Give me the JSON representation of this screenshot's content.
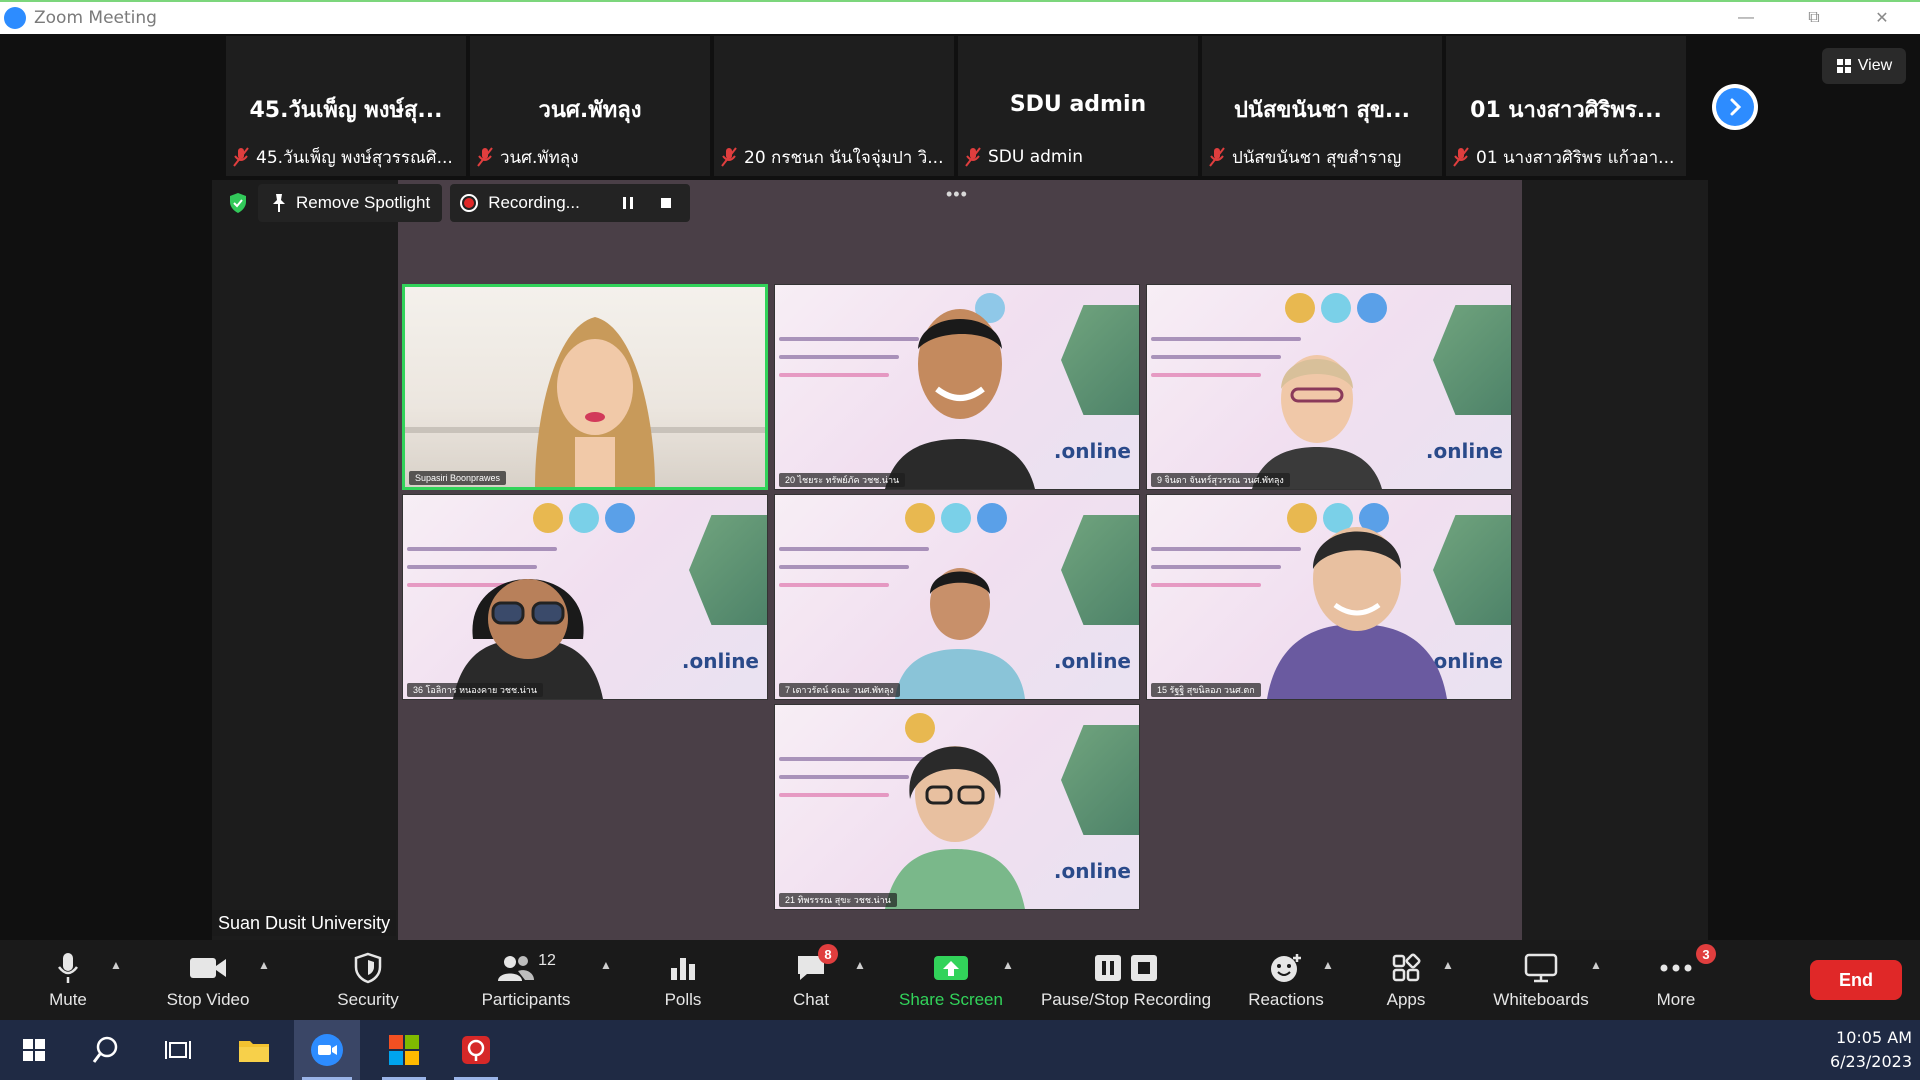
{
  "window": {
    "title": "Zoom Meeting"
  },
  "filmstrip": [
    {
      "name": "45.วันเพ็ญ พงษ์สุ...",
      "sub": "45.วันเพ็ญ พงษ์สุวรรณศิ..."
    },
    {
      "name": "วนศ.พัทลุง",
      "sub": "วนศ.พัทลุง"
    },
    {
      "name": "",
      "sub": "20 กรชนก นันใจจุ่มปา วิ..."
    },
    {
      "name": "SDU admin",
      "sub": "SDU admin"
    },
    {
      "name": "ปนัสขนันชา สุข...",
      "sub": "ปนัสขนันชา สุขสำราญ"
    },
    {
      "name": "01 นางสาวศิริพร...",
      "sub": "01 นางสาวศิริพร  แก้วอา..."
    }
  ],
  "view_button": {
    "label": "View"
  },
  "stage_toolbar": {
    "spotlight_label": "Remove Spotlight",
    "recording_label": "Recording..."
  },
  "videos": [
    {
      "name": "Supasiri Boonprawes"
    },
    {
      "name": "20 ไชยระ ทรัพย์ภัค วชช.น่าน"
    },
    {
      "name": "9 จินดา จันทร์สุวรรณ วนศ.พัทลุง"
    },
    {
      "name": "36 โอลิการ หนองคาย วชช.น่าน"
    },
    {
      "name": "7 เดาวรัตน์ คณะ วนศ.พัทลุง"
    },
    {
      "name": "15 รัฐฐิ สุขนิลอภ วนศ.ตก"
    },
    {
      "name": "21 ทิพรรรณ สุขะ วชช.น่าน"
    }
  ],
  "video_slide_text": ".online",
  "org_label": "Suan Dusit University",
  "toolbar": {
    "mute": "Mute",
    "stop_video": "Stop Video",
    "security": "Security",
    "participants": "Participants",
    "participants_count": "12",
    "polls": "Polls",
    "chat": "Chat",
    "chat_badge": "8",
    "share_screen": "Share Screen",
    "pause_stop_recording": "Pause/Stop Recording",
    "reactions": "Reactions",
    "apps": "Apps",
    "whiteboards": "Whiteboards",
    "more": "More",
    "more_badge": "3",
    "end": "End"
  },
  "taskbar": {
    "time": "10:05 AM",
    "date": "6/23/2023"
  },
  "colors": {
    "accent": "#2d8cff",
    "end": "#e02828",
    "share": "#32d35a",
    "active_border": "#32d35a"
  }
}
